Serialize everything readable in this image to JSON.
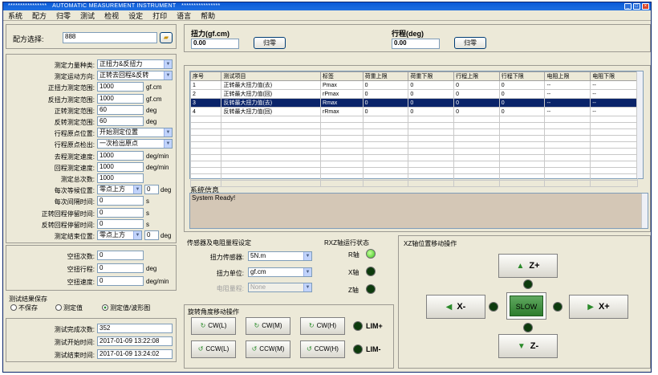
{
  "window": {
    "title": "AUTOMATIC MEASUREMENT INSTRUMENT",
    "stars_left": "****************",
    "stars_right": "****************"
  },
  "menu": [
    "系统",
    "配方",
    "归零",
    "测试",
    "检视",
    "设定",
    "打印",
    "语言",
    "帮助"
  ],
  "recipe": {
    "label": "配方选择:",
    "value": "888"
  },
  "params": [
    {
      "label": "测定力量种类:",
      "value": "正扭力&反扭力",
      "type": "select"
    },
    {
      "label": "测定运动方向:",
      "value": "正转去回程&反转",
      "type": "select"
    },
    {
      "label": "正扭力测定范围:",
      "value": "1000",
      "unit": "gf.cm",
      "type": "text"
    },
    {
      "label": "反扭力测定范围:",
      "value": "1000",
      "unit": "gf.cm",
      "type": "text"
    },
    {
      "label": "正转测定范围:",
      "value": "60",
      "unit": "deg",
      "type": "text"
    },
    {
      "label": "反转测定范围:",
      "value": "60",
      "unit": "deg",
      "type": "text"
    },
    {
      "label": "行程原点位置:",
      "value": "开始测定位置",
      "type": "select"
    },
    {
      "label": "行程原点检出:",
      "value": "一次检出原点",
      "type": "select"
    },
    {
      "label": "去程测定速度:",
      "value": "1000",
      "unit": "deg/min",
      "type": "text"
    },
    {
      "label": "回程测定速度:",
      "value": "1000",
      "unit": "deg/min",
      "type": "text"
    },
    {
      "label": "测定总次数:",
      "value": "1000",
      "type": "text"
    },
    {
      "label": "每次等候位置:",
      "value": "零点上方",
      "value2": "0",
      "unit": "deg",
      "type": "select2"
    },
    {
      "label": "每次间隔时间:",
      "value": "0",
      "unit": "s",
      "type": "text"
    },
    {
      "label": "正转回程停留时间:",
      "value": "0",
      "unit": "s",
      "type": "text"
    },
    {
      "label": "反转回程停留时间:",
      "value": "0",
      "unit": "s",
      "type": "text"
    },
    {
      "label": "测定结束位置:",
      "value": "零点上方",
      "value2": "0",
      "unit": "deg",
      "type": "select2"
    }
  ],
  "idle": [
    {
      "label": "空扭次数:",
      "value": "0",
      "unit": ""
    },
    {
      "label": "空扭行程:",
      "value": "0",
      "unit": "deg"
    },
    {
      "label": "空扭速度:",
      "value": "0",
      "unit": "deg/min"
    }
  ],
  "save": {
    "title": "测试结果保存",
    "options": [
      "不保存",
      "测定值",
      "测定值/波形图"
    ],
    "selected": 2
  },
  "stats": [
    {
      "label": "测试完成次数:",
      "value": "352"
    },
    {
      "label": "测试开始时间:",
      "value": "2017-01-09 13:22:08"
    },
    {
      "label": "测试结束时间:",
      "value": "2017-01-09 13:24:02"
    }
  ],
  "torque": {
    "label": "扭力(gf.cm)",
    "value": "0.00",
    "zero": "归零"
  },
  "stroke": {
    "label": "行程(deg)",
    "value": "0.00",
    "zero": "归零"
  },
  "table": {
    "headers": [
      "序号",
      "测试项目",
      "标签",
      "荷重上限",
      "荷重下限",
      "行程上限",
      "行程下限",
      "电阻上限",
      "电阻下限"
    ],
    "rows": [
      [
        "1",
        "正转最大扭力值(去)",
        "Pmax",
        "0",
        "0",
        "0",
        "0",
        "--",
        "--"
      ],
      [
        "2",
        "正转最大扭力值(回)",
        "rPmax",
        "0",
        "0",
        "0",
        "0",
        "--",
        "--"
      ],
      [
        "3",
        "反转最大扭力值(去)",
        "Rmax",
        "0",
        "0",
        "0",
        "0",
        "--",
        "--"
      ],
      [
        "4",
        "反转最大扭力值(回)",
        "rRmax",
        "0",
        "0",
        "0",
        "0",
        "--",
        "--"
      ]
    ],
    "selected": 2
  },
  "sysinfo": {
    "title": "系统信息",
    "text": "System Ready!"
  },
  "sensor": {
    "title": "传感器及电阻量程设定",
    "torque_label": "扭力传感器:",
    "torque_value": "5N.m",
    "unit_label": "扭力单位:",
    "unit_value": "gf.cm",
    "res_label": "电阻量程:",
    "res_value": "None"
  },
  "rxz": {
    "title": "RXZ轴运行状态",
    "axes": [
      "R轴",
      "X轴",
      "Z轴"
    ],
    "on": [
      true,
      false,
      false
    ]
  },
  "rotate": {
    "title": "旋转角度移动操作",
    "cw": [
      "CW(L)",
      "CW(M)",
      "CW(H)"
    ],
    "ccw": [
      "CCW(L)",
      "CCW(M)",
      "CCW(H)"
    ],
    "lim_plus": "LIM+",
    "lim_minus": "LIM-"
  },
  "xz": {
    "title": "XZ轴位置移动操作",
    "zp": "Z+",
    "zm": "Z-",
    "xp": "X+",
    "xm": "X-",
    "slow": "SLOW"
  },
  "colors": {
    "title_bar": "#0a5ad8",
    "selected_row": "#0a246a",
    "led_on": "#35c21a",
    "led_off": "#0d3b0d",
    "slow": "#2e7d2e"
  }
}
